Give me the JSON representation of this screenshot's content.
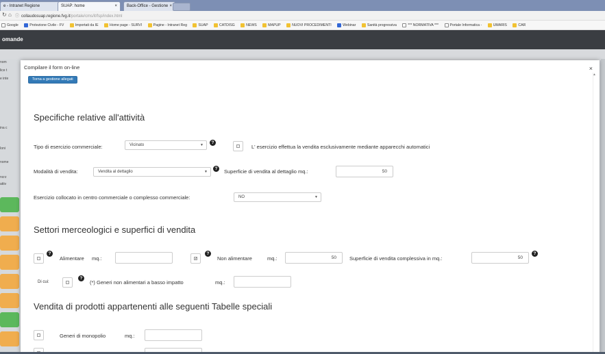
{
  "browser": {
    "tabs": [
      {
        "label": "e - Intranet Regione",
        "close": "×"
      },
      {
        "label": "SUAP: home",
        "close": "×"
      },
      {
        "label": "Back-Office - Gestione",
        "close": "×"
      }
    ],
    "url_scheme_icon": "info-icon",
    "url_host": "collaudosuap.regione.fvg.it",
    "url_path": "/portale/cms/it/fsp/index.html",
    "bookmarks": [
      "Google",
      "Protezione Civile - FV",
      "Importati da IE",
      "Home page - SURVI",
      "Pagine - Intranet Reg",
      "SUAP",
      "CATDISG",
      "NEWS",
      "MAPUP",
      "NUOVI PROCEDIMENTI",
      "Webinar",
      "Sanità progressiva",
      "*** NORMATIVA ***",
      "Portale Informatica -",
      "UMARIS",
      "CAR"
    ]
  },
  "app": {
    "header_title": "omande"
  },
  "background": {
    "left_labels": [
      "nom",
      "lice t",
      "e inte",
      "ina c",
      "Ioni",
      "nome",
      "ncrz",
      "attiv"
    ],
    "button_colors": [
      "#5cb85c",
      "#f0ad4e",
      "#f0ad4e",
      "#f0ad4e",
      "#f0ad4e",
      "#f0ad4e",
      "#5cb85c",
      "#f0ad4e"
    ]
  },
  "modal": {
    "title": "Compilare il form on-line",
    "close": "×",
    "back_button": "Torna a gestione allegati",
    "section1": {
      "title": "Specifiche relative all'attività",
      "tipo_label": "Tipo di esercizio commerciale:",
      "tipo_value": "Vicinato",
      "automatici_label": "L' esercizio effettua la vendita esclusivamente mediante apparecchi automatici",
      "modalita_label": "Modalità di vendita:",
      "modalita_value": "Vendita al dettaglio",
      "superficie_dettaglio_label": "Superficie di vendita al dettaglio mq.:",
      "superficie_dettaglio_value": "50",
      "centro_label": "Esercizio collocato in centro commerciale o complesso commerciale:",
      "centro_value": "NO"
    },
    "section2": {
      "title": "Settori merceologici e superfici di vendita",
      "alimentare_label": "Alimentare",
      "mq_label": "mq.:",
      "alimentare_value": "",
      "non_alimentare_label": "Non alimentare",
      "non_alimentare_value": "50",
      "non_alimentare_checked": true,
      "complessiva_label": "Superficie di vendita complessiva in mq.:",
      "complessiva_value": "50",
      "dicui_label": "Di cui:",
      "basso_impatto_label": "(*) Generi non alimentari a basso impatto",
      "basso_impatto_value": ""
    },
    "section3": {
      "title": "Vendita di prodotti appartenenti alle seguenti Tabelle speciali",
      "monopolio_label": "Generi di monopolio",
      "monopolio_value": ""
    },
    "help_glyph": "?",
    "check_glyph": "✓"
  },
  "colors": {
    "tabbar": "#7d8fb4",
    "app_header": "#3a3d42",
    "primary_button": "#337ab7"
  }
}
